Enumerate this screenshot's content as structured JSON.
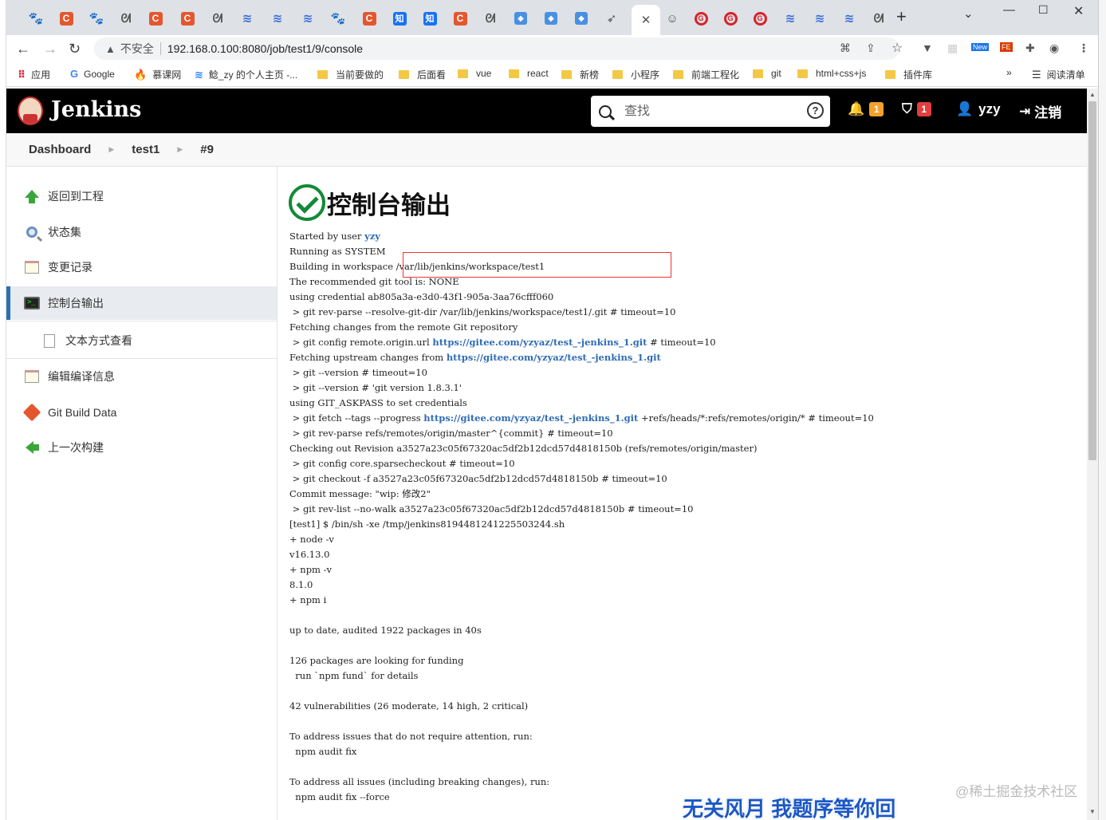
{
  "browser": {
    "tabs": [
      {
        "icon": "paw-icon",
        "glyph": "🐾"
      },
      {
        "icon": "csdn-icon",
        "glyph": "C"
      },
      {
        "icon": "paw-icon",
        "glyph": "🐾"
      },
      {
        "icon": "github-icon",
        "glyph": "ᘛ"
      },
      {
        "icon": "csdn-icon",
        "glyph": "C"
      },
      {
        "icon": "csdn-icon",
        "glyph": "C"
      },
      {
        "icon": "github-icon",
        "glyph": "ᘛ"
      },
      {
        "icon": "juejin-icon",
        "glyph": "≋"
      },
      {
        "icon": "juejin-icon",
        "glyph": "≋"
      },
      {
        "icon": "juejin-icon",
        "glyph": "≋"
      },
      {
        "icon": "paw-icon",
        "glyph": "🐾"
      },
      {
        "icon": "csdn-icon",
        "glyph": "C"
      },
      {
        "icon": "zhihu-icon",
        "glyph": "知"
      },
      {
        "icon": "zhihu-icon",
        "glyph": "知"
      },
      {
        "icon": "csdn-icon",
        "glyph": "C"
      },
      {
        "icon": "github-icon",
        "glyph": "ᘛ"
      },
      {
        "icon": "cube-icon",
        "glyph": "◆"
      },
      {
        "icon": "cube-icon",
        "glyph": "◆"
      },
      {
        "icon": "cube-icon",
        "glyph": "◆"
      },
      {
        "icon": "leaf-icon",
        "glyph": "➶"
      },
      {
        "icon": "close-icon",
        "glyph": "✕"
      },
      {
        "icon": "jenkins-icon",
        "glyph": "☺"
      },
      {
        "icon": "gitee-icon",
        "glyph": "G"
      },
      {
        "icon": "gitee-icon",
        "glyph": "G"
      },
      {
        "icon": "gitee-icon",
        "glyph": "G"
      },
      {
        "icon": "juejin-icon",
        "glyph": "≋"
      },
      {
        "icon": "juejin-icon",
        "glyph": "≋"
      },
      {
        "icon": "juejin-icon",
        "glyph": "≋"
      },
      {
        "icon": "github-icon",
        "glyph": "ᘛ"
      }
    ],
    "new_tab": "+",
    "address": {
      "insecure_label": "不安全",
      "url": "192.168.0.100:8080/job/test1/9/console"
    },
    "bookmarks": [
      {
        "label": "应用",
        "icon": "apps-icon"
      },
      {
        "label": "Google",
        "icon": "google-icon"
      },
      {
        "label": "慕课网",
        "icon": "imooc-icon"
      },
      {
        "label": "鲶_zy 的个人主页 -...",
        "icon": "juejin-icon"
      },
      {
        "label": "当前要做的",
        "icon": "folder-icon"
      },
      {
        "label": "后面看",
        "icon": "folder-icon"
      },
      {
        "label": "vue",
        "icon": "folder-icon"
      },
      {
        "label": "react",
        "icon": "folder-icon"
      },
      {
        "label": "新榜",
        "icon": "folder-icon"
      },
      {
        "label": "小程序",
        "icon": "folder-icon"
      },
      {
        "label": "前端工程化",
        "icon": "folder-icon"
      },
      {
        "label": "git",
        "icon": "folder-icon"
      },
      {
        "label": "html+css+js",
        "icon": "folder-icon"
      },
      {
        "label": "插件库",
        "icon": "folder-icon"
      }
    ],
    "bookmarks_more": "»",
    "reading_list": "阅读清单"
  },
  "header": {
    "brand": "Jenkins",
    "search_placeholder": "查找",
    "notifications_count": "1",
    "security_count": "1",
    "user": "yzy",
    "logout": "注销"
  },
  "breadcrumb": [
    "Dashboard",
    "test1",
    "#9"
  ],
  "sidebar": {
    "items": [
      {
        "label": "返回到工程",
        "icon": "up-arrow-icon"
      },
      {
        "label": "状态集",
        "icon": "magnifier-icon"
      },
      {
        "label": "变更记录",
        "icon": "notepad-icon"
      },
      {
        "label": "控制台输出",
        "icon": "terminal-icon"
      },
      {
        "label": "文本方式查看",
        "icon": "document-icon"
      },
      {
        "label": "编辑编译信息",
        "icon": "notepad-icon"
      },
      {
        "label": "Git Build Data",
        "icon": "git-icon"
      },
      {
        "label": "上一次构建",
        "icon": "left-arrow-icon"
      }
    ]
  },
  "main": {
    "title": "控制台输出",
    "console": {
      "user": "yzy",
      "line_started": "Started by user ",
      "l1": "Running as SYSTEM",
      "l2": "Building in workspace /var/lib/jenkins/workspace/test1",
      "l3": "The recommended git tool is: NONE",
      "l4": "using credential ab805a3a-e3d0-43f1-905a-3aa76cfff060",
      "l5": " > git rev-parse --resolve-git-dir /var/lib/jenkins/workspace/test1/.git # timeout=10",
      "l6": "Fetching changes from the remote Git repository",
      "l7a": " > git config remote.origin.url ",
      "repo": "https://gitee.com/yzyaz/test_-jenkins_1.git",
      "l7b": " # timeout=10",
      "l8a": "Fetching upstream changes from ",
      "l9": " > git --version # timeout=10",
      "l10": " > git --version # 'git version 1.8.3.1'",
      "l11": "using GIT_ASKPASS to set credentials",
      "l12a": " > git fetch --tags --progress ",
      "l12b": " +refs/heads/*:refs/remotes/origin/* # timeout=10",
      "l13": " > git rev-parse refs/remotes/origin/master^{commit} # timeout=10",
      "l14": "Checking out Revision a3527a23c05f67320ac5df2b12dcd57d4818150b (refs/remotes/origin/master)",
      "l15": " > git config core.sparsecheckout # timeout=10",
      "l16": " > git checkout -f a3527a23c05f67320ac5df2b12dcd57d4818150b # timeout=10",
      "l17": "Commit message: \"wip: 修改2\"",
      "l18": " > git rev-list --no-walk a3527a23c05f67320ac5df2b12dcd57d4818150b # timeout=10",
      "l19": "[test1] $ /bin/sh -xe /tmp/jenkins8194481241225503244.sh",
      "l20": "+ node -v",
      "l21": "v16.13.0",
      "l22": "+ npm -v",
      "l23": "8.1.0",
      "l24": "+ npm i",
      "l25": "up to date, audited 1922 packages in 40s",
      "l26": "126 packages are looking for funding",
      "l27": "  run `npm fund` for details",
      "l28": "42 vulnerabilities (26 moderate, 14 high, 2 critical)",
      "l29": "To address issues that do not require attention, run:",
      "l30": "  npm audit fix",
      "l31": "To address all issues (including breaking changes), run:",
      "l32": "  npm audit fix --force"
    }
  },
  "watermarks": {
    "juejin": "@稀土掘金技术社区",
    "overlay": "无关风月 我题序等你回"
  },
  "colors": {
    "jenkins_header": "#000000",
    "success_green": "#138a36",
    "link_blue": "#2f6bb3",
    "highlight_red": "#e33333",
    "badge_orange": "#f3a12b",
    "badge_red": "#e23e3e"
  }
}
